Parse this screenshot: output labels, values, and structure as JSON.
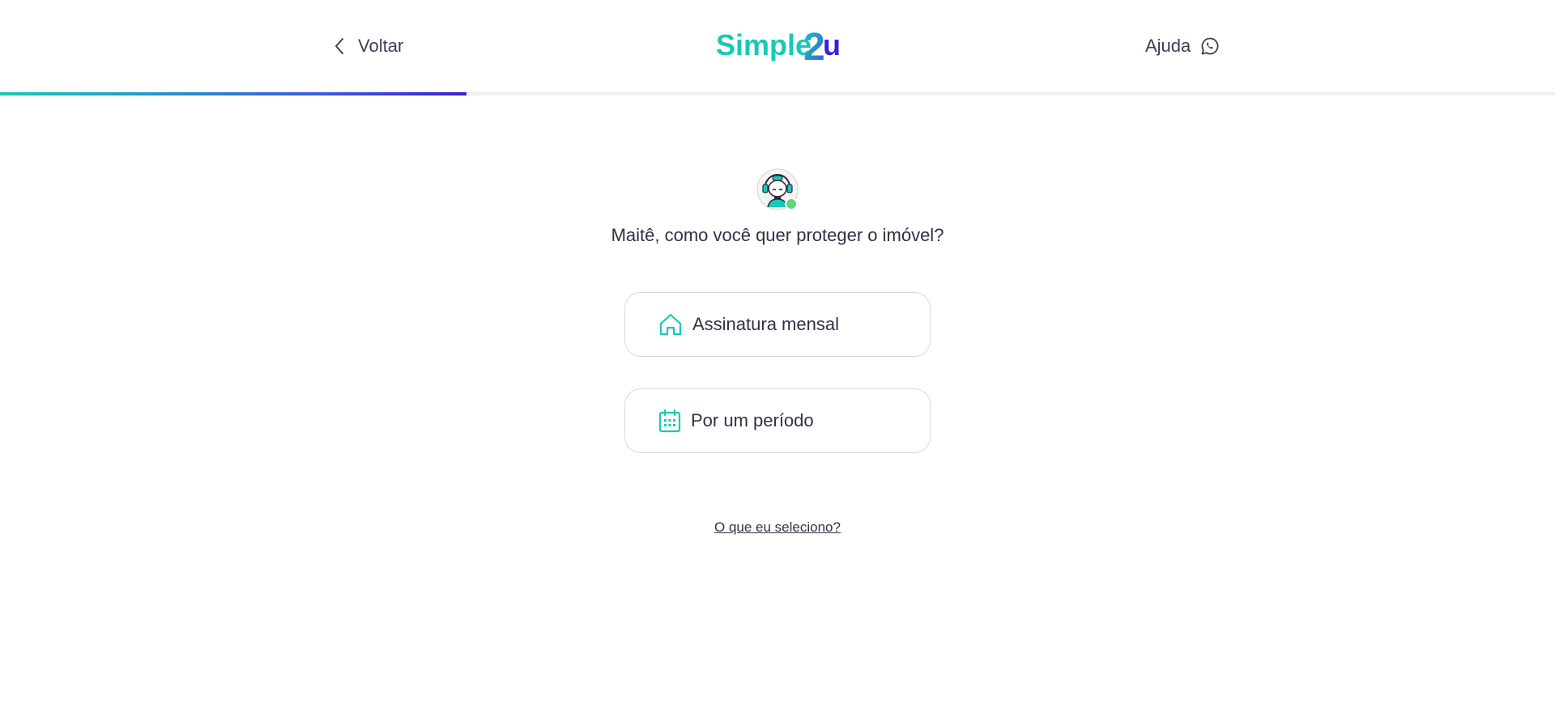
{
  "header": {
    "back_label": "Voltar",
    "logo_text_main": "Simple",
    "logo_text_2": "2",
    "logo_text_u": "u",
    "help_label": "Ajuda"
  },
  "progress": {
    "fraction": 0.3
  },
  "main": {
    "question": "Maitê, como você quer proteger o imóvel?",
    "options": [
      {
        "label": "Assinatura mensal",
        "icon": "home-icon"
      },
      {
        "label": "Por um período",
        "icon": "calendar-icon"
      }
    ],
    "help_link": "O que eu seleciono?"
  },
  "colors": {
    "accent_teal": "#19c9b6",
    "accent_purple": "#3d1fd8",
    "online_green": "#5fd67a"
  }
}
